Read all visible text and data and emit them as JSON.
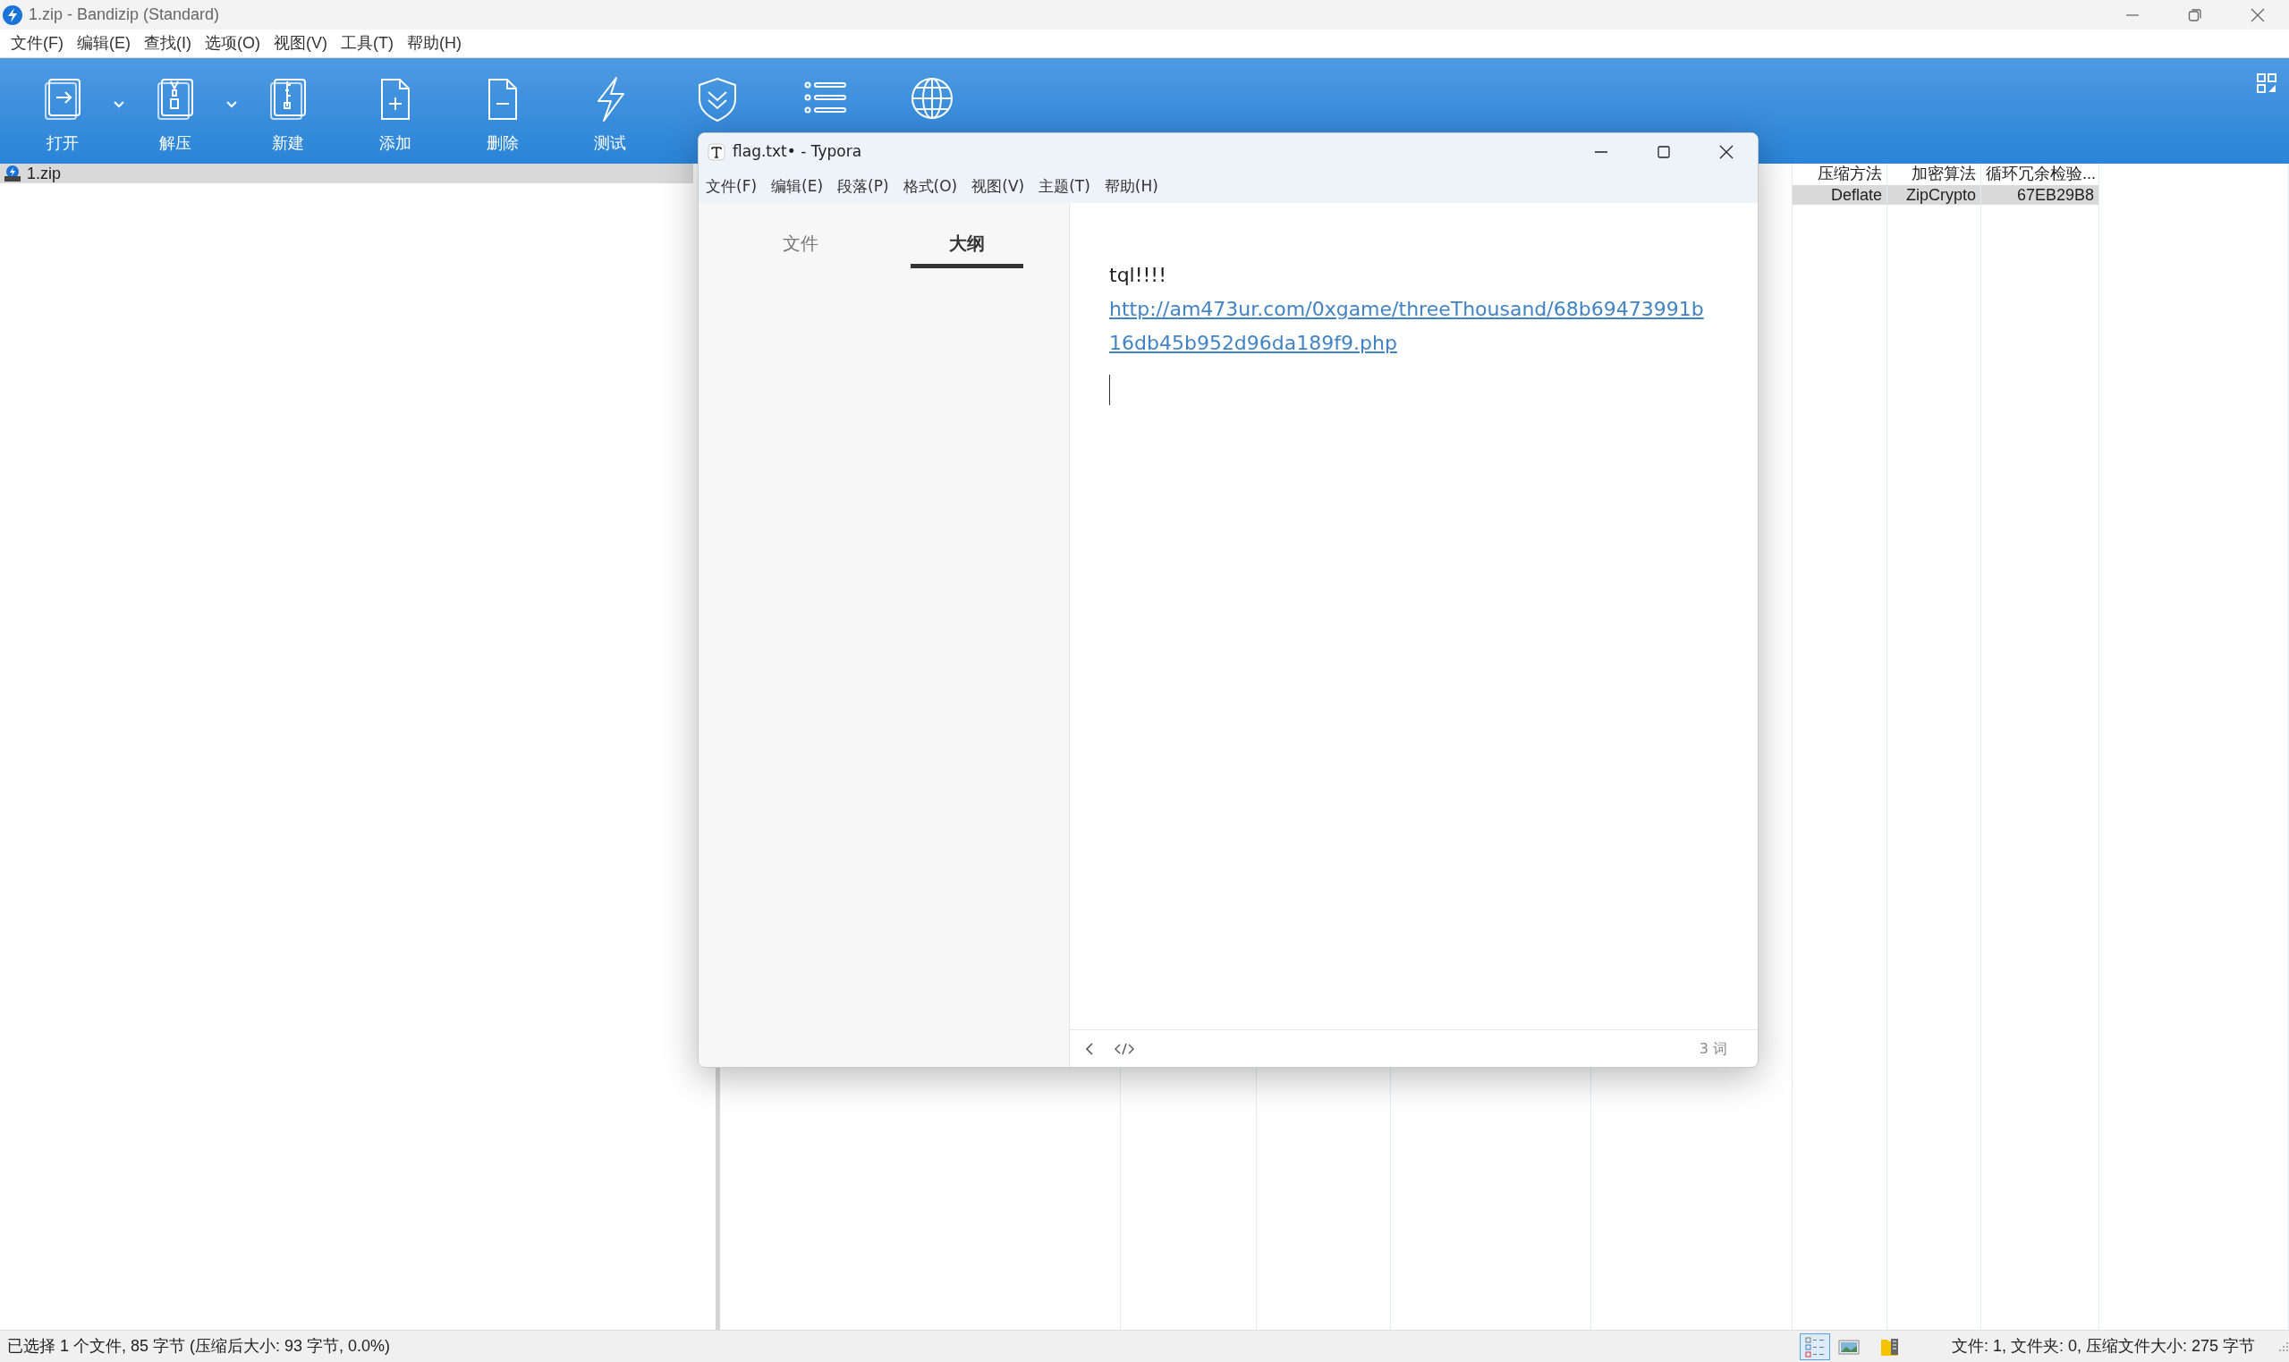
{
  "bandizip": {
    "title": "1.zip - Bandizip (Standard)",
    "menu": [
      "文件(F)",
      "编辑(E)",
      "查找(I)",
      "选项(O)",
      "视图(V)",
      "工具(T)",
      "帮助(H)"
    ],
    "toolbar": [
      {
        "kind": "open",
        "label": "打开",
        "dropdown": true
      },
      {
        "kind": "extract",
        "label": "解压",
        "dropdown": true
      },
      {
        "kind": "new",
        "label": "新建",
        "dropdown": false
      },
      {
        "kind": "add",
        "label": "添加",
        "dropdown": false
      },
      {
        "kind": "delete",
        "label": "删除",
        "dropdown": false
      },
      {
        "kind": "test",
        "label": "测试",
        "dropdown": false
      },
      {
        "kind": "shield",
        "dropdown": false
      },
      {
        "kind": "list",
        "dropdown": false
      },
      {
        "kind": "globe",
        "dropdown": false
      }
    ],
    "tree": [
      {
        "label": "1.zip",
        "selected": true
      }
    ],
    "file_list": {
      "columns": [
        "压缩方法",
        "加密算法",
        "循环冗余检验..."
      ],
      "rows": [
        {
          "cells": [
            "Deflate",
            "ZipCrypto",
            "67EB29B8"
          ],
          "selected": true
        }
      ]
    },
    "status_bar": {
      "left": "已选择 1 个文件, 85 字节 (压缩后大小: 93 字节, 0.0%)",
      "views": [
        {
          "kind": "details",
          "selected": true
        },
        {
          "kind": "thumbnails",
          "selected": false
        }
      ],
      "right": "文件: 1, 文件夹: 0, 压缩文件大小: 275 字节"
    }
  },
  "typora": {
    "title": "flag.txt• - Typora",
    "menu": [
      "文件(F)",
      "编辑(E)",
      "段落(P)",
      "格式(O)",
      "视图(V)",
      "主题(T)",
      "帮助(H)"
    ],
    "sidebar_tabs": [
      {
        "label": "文件",
        "selected": false
      },
      {
        "label": "大纲",
        "selected": true
      }
    ],
    "content": [
      {
        "kind": "text",
        "text": "tql!!!!"
      },
      {
        "kind": "link",
        "text": "http://am473ur.com/0xgame/threeThousand/68b69473991b16db45b952d96da189f9.php"
      }
    ],
    "word_count": "3 词"
  }
}
